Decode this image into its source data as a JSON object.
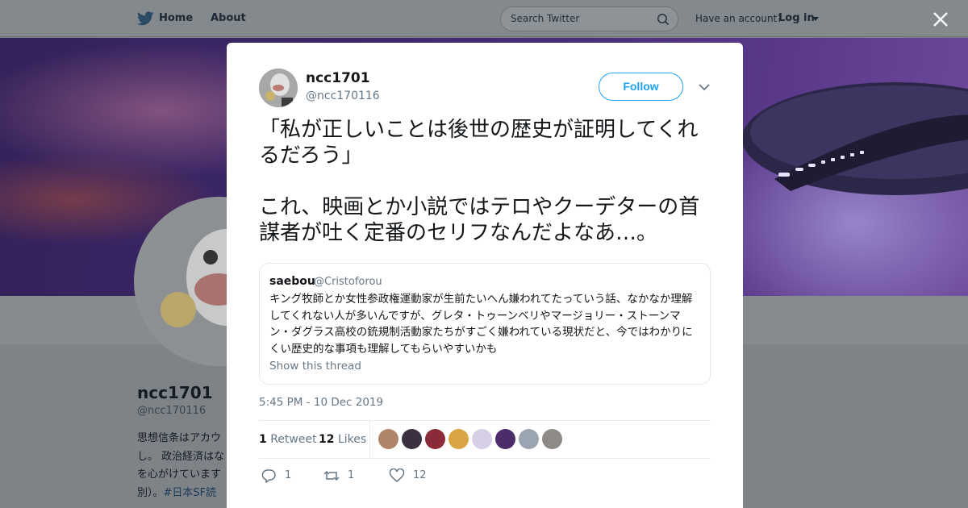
{
  "topbar": {
    "home_label": "Home",
    "about_label": "About",
    "search_placeholder": "Search Twitter",
    "account_prompt": "Have an account?",
    "login_label": "Log in"
  },
  "profile": {
    "name": "ncc1701",
    "handle": "@ncc170116",
    "bio_lines": [
      "思想信条はアカウ",
      "し。 政治経済はな",
      "を心がけています",
      "別）。"
    ],
    "bio_hashtag": "#日本SF読"
  },
  "tweet": {
    "name": "ncc1701",
    "handle": "@ncc170116",
    "follow_label": "Follow",
    "text": "「私が正しいことは後世の歴史が証明してくれるだろう」\n\nこれ、映画とか小説ではテロやクーデターの首謀者が吐く定番のセリフなんだよなあ…。",
    "quoted": {
      "name": "saebou",
      "handle": "@Cristoforou",
      "text": "キング牧師とか女性参政権運動家が生前たいへん嫌われてたっていう話、なかなか理解してくれない人が多いんですが、グレタ・トゥーンベリやマージョリー・ストーンマン・ダグラス高校の銃規制活動家たちがすごく嫌われている現状だと、今ではわかりにくい歴史的な事項も理解してもらいやすいかも",
      "show_thread": "Show this thread"
    },
    "timestamp": "5:45 PM - 10 Dec 2019",
    "retweet_count": "1",
    "retweet_label": "Retweet",
    "likes_count": "12",
    "likes_label": "Likes",
    "actions": {
      "reply_count": "1",
      "retweet_count": "1",
      "like_count": "12"
    }
  },
  "colors": {
    "accent": "#1da1f2",
    "secondary_text": "#657786"
  }
}
